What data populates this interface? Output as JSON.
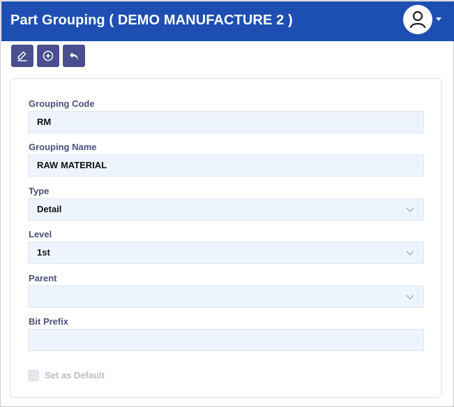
{
  "header": {
    "title": "Part Grouping ( DEMO MANUFACTURE 2 )",
    "avatar_icon": "user-icon",
    "menu_icon": "caret-down-icon",
    "background": "#1d4fb3"
  },
  "toolbar": {
    "buttons": [
      {
        "name": "edit",
        "icon": "pencil-icon"
      },
      {
        "name": "add",
        "icon": "plus-circle-icon"
      },
      {
        "name": "back",
        "icon": "undo-arrow-icon"
      }
    ],
    "button_color": "#4a4f8f"
  },
  "form": {
    "grouping_code": {
      "label": "Grouping Code",
      "value": "RM"
    },
    "grouping_name": {
      "label": "Grouping Name",
      "value": "RAW MATERIAL"
    },
    "type": {
      "label": "Type",
      "value": "Detail"
    },
    "level": {
      "label": "Level",
      "value": "1st"
    },
    "parent": {
      "label": "Parent",
      "value": ""
    },
    "bit_prefix": {
      "label": "Bit Prefix",
      "value": ""
    },
    "set_as_default": {
      "label": "Set as Default",
      "checked": false
    }
  }
}
